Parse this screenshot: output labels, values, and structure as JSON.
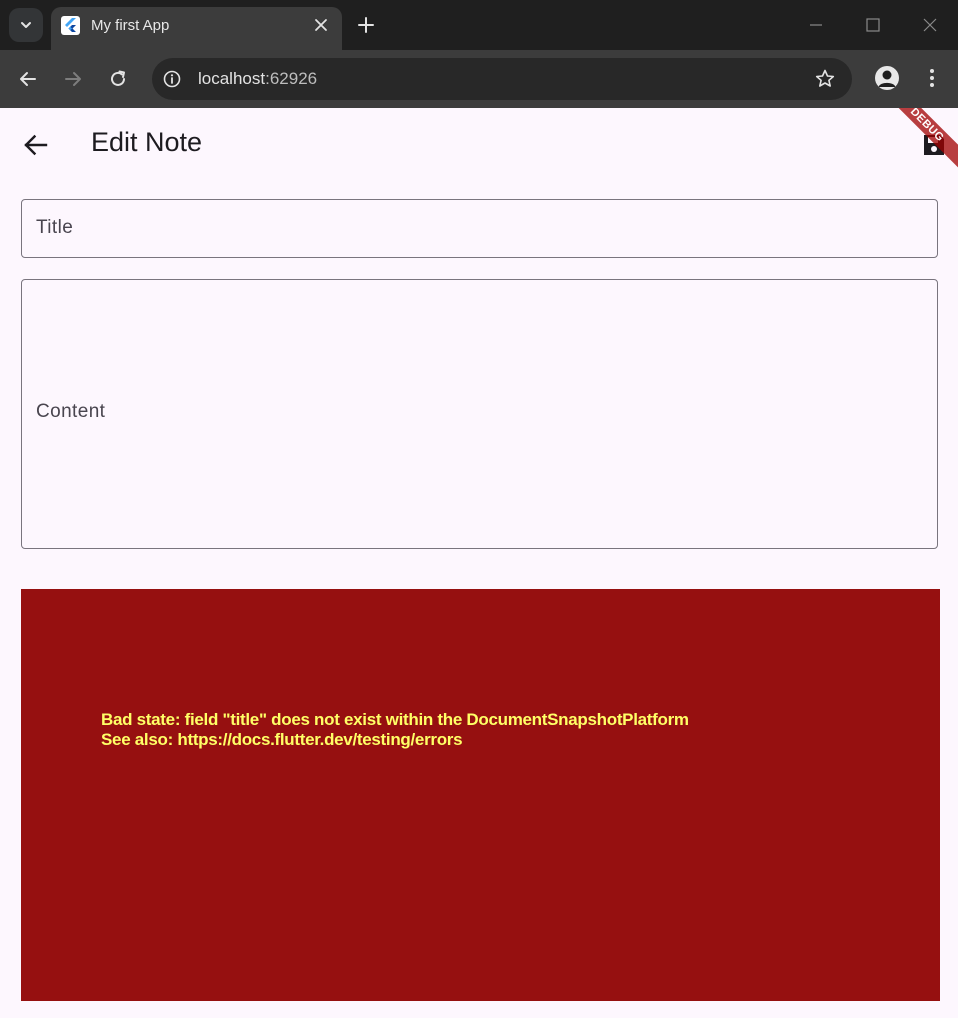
{
  "browser": {
    "tab_title": "My first App",
    "url_host": "localhost",
    "url_path": ":62926"
  },
  "icons": {
    "tab_search": "chevron-down-icon",
    "favicon": "flutter-logo-icon",
    "tab_close": "close-icon",
    "new_tab": "plus-icon",
    "minimize": "minimize-icon",
    "maximize": "maximize-icon",
    "close_window": "close-icon",
    "back": "arrow-left-icon",
    "forward": "arrow-right-icon",
    "reload": "reload-icon",
    "site_info": "info-icon",
    "bookmark": "star-icon",
    "profile": "account-icon",
    "menu": "kebab-menu-icon",
    "app_back": "arrow-left-icon",
    "app_action": "save-icon"
  },
  "app": {
    "appbar_title": "Edit Note",
    "debug_banner": "DEBUG",
    "title_label": "Title",
    "content_label": "Content",
    "error_line1": "Bad state: field \"title\" does not exist within the DocumentSnapshotPlatform",
    "error_line2": "See also: https://docs.flutter.dev/testing/errors"
  },
  "colors": {
    "chrome_dark": "#1f1f1f",
    "chrome_toolbar": "#3c3c3c",
    "app_background": "#fdf7fe",
    "error_background": "#961010",
    "error_text": "#ffff66",
    "field_outline": "#79747e"
  }
}
